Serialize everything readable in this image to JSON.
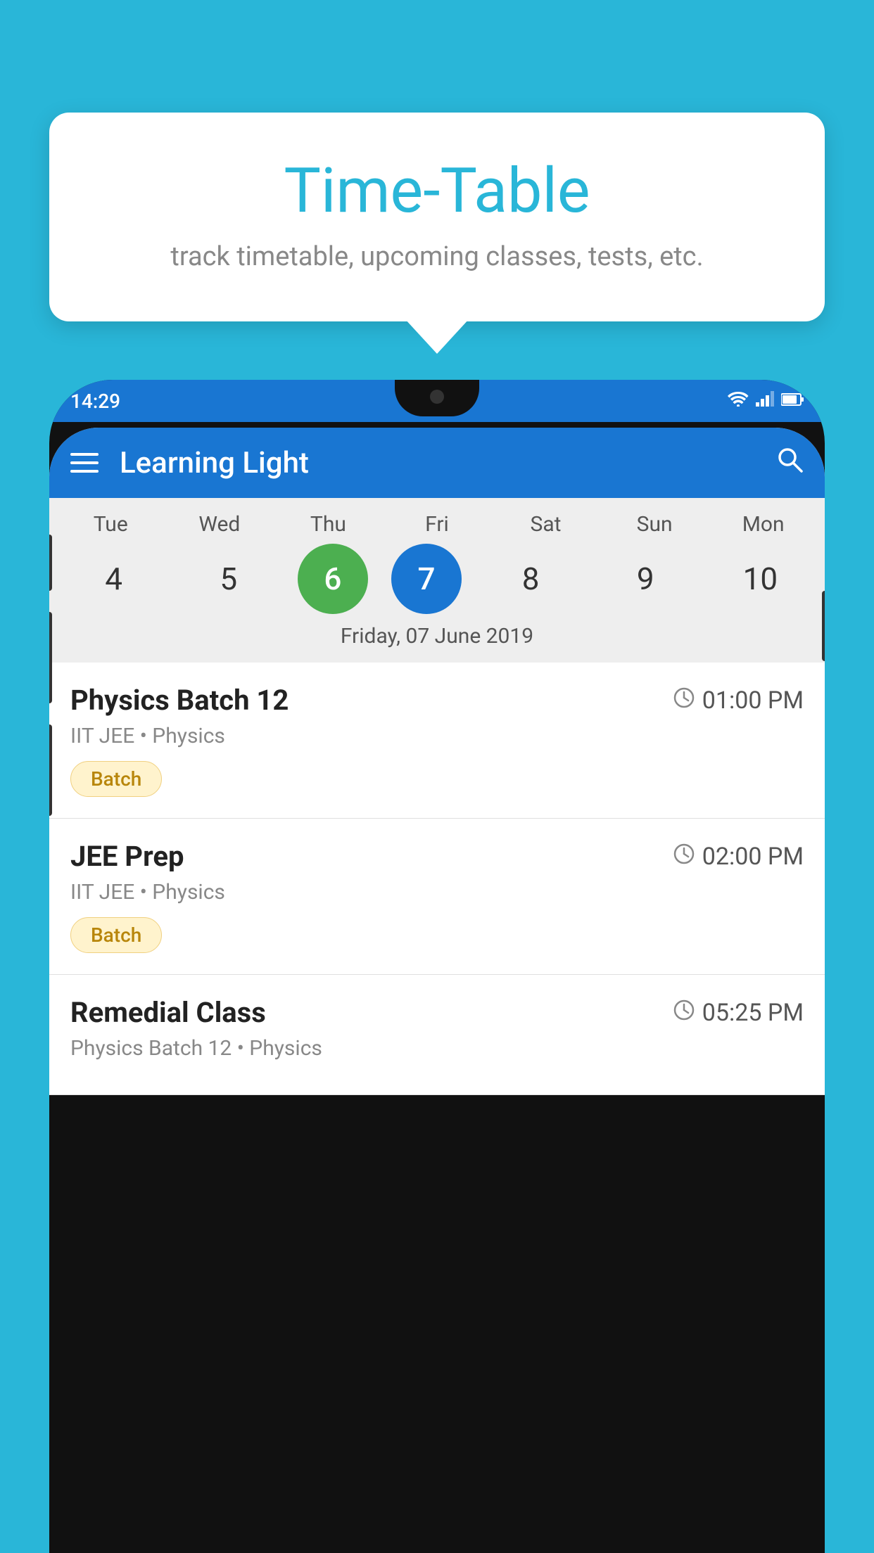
{
  "background_color": "#29B6D8",
  "bubble": {
    "title": "Time-Table",
    "subtitle": "track timetable, upcoming classes, tests, etc."
  },
  "phone": {
    "status_bar": {
      "time": "14:29",
      "icons": [
        "wifi",
        "signal",
        "battery"
      ]
    },
    "app_bar": {
      "title": "Learning Light",
      "menu_icon": "hamburger-icon",
      "search_icon": "search-icon"
    },
    "calendar": {
      "days": [
        {
          "label": "Tue",
          "number": "4"
        },
        {
          "label": "Wed",
          "number": "5"
        },
        {
          "label": "Thu",
          "number": "6",
          "state": "today"
        },
        {
          "label": "Fri",
          "number": "7",
          "state": "selected"
        },
        {
          "label": "Sat",
          "number": "8"
        },
        {
          "label": "Sun",
          "number": "9"
        },
        {
          "label": "Mon",
          "number": "10"
        }
      ],
      "selected_date_label": "Friday, 07 June 2019"
    },
    "schedule": [
      {
        "title": "Physics Batch 12",
        "time": "01:00 PM",
        "subtitle": "IIT JEE • Physics",
        "tag": "Batch"
      },
      {
        "title": "JEE Prep",
        "time": "02:00 PM",
        "subtitle": "IIT JEE • Physics",
        "tag": "Batch"
      },
      {
        "title": "Remedial Class",
        "time": "05:25 PM",
        "subtitle": "Physics Batch 12 • Physics",
        "tag": null
      }
    ]
  }
}
